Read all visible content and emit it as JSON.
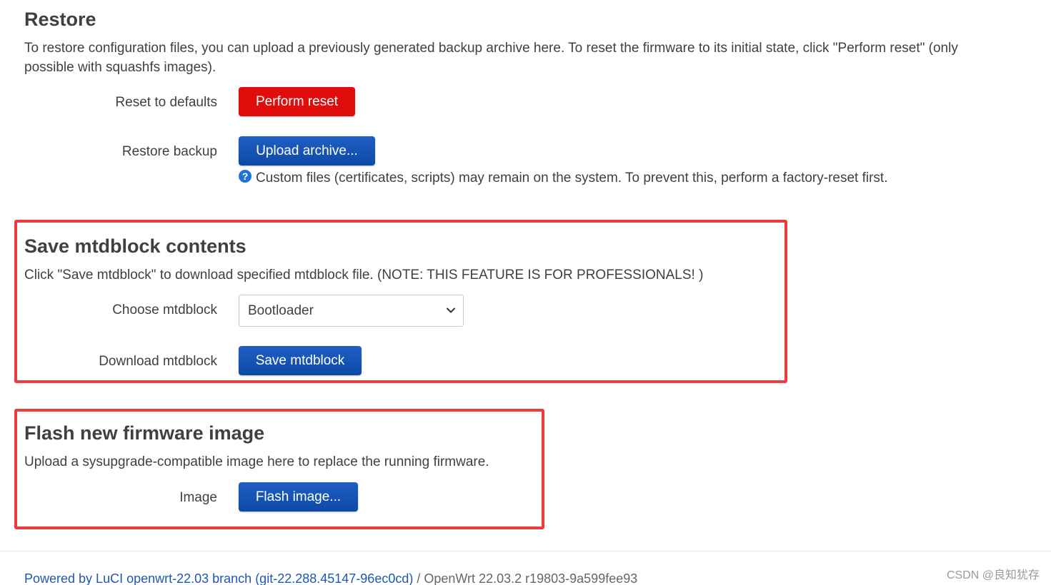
{
  "restore": {
    "title": "Restore",
    "description": "To restore configuration files, you can upload a previously generated backup archive here. To reset the firmware to its initial state, click \"Perform reset\" (only possible with squashfs images).",
    "reset_label": "Reset to defaults",
    "reset_button": "Perform reset",
    "backup_label": "Restore backup",
    "upload_button": "Upload archive...",
    "hint_icon": "?",
    "hint": "Custom files (certificates, scripts) may remain on the system. To prevent this, perform a factory-reset first."
  },
  "mtdblock": {
    "title": "Save mtdblock contents",
    "description": "Click \"Save mtdblock\" to download specified mtdblock file. (NOTE: THIS FEATURE IS FOR PROFESSIONALS! )",
    "choose_label": "Choose mtdblock",
    "selected": "Bootloader",
    "download_label": "Download mtdblock",
    "save_button": "Save mtdblock"
  },
  "flash": {
    "title": "Flash new firmware image",
    "description": "Upload a sysupgrade-compatible image here to replace the running firmware.",
    "image_label": "Image",
    "flash_button": "Flash image..."
  },
  "footer": {
    "link": "Powered by LuCI openwrt-22.03 branch (git-22.288.45147-96ec0cd)",
    "separator": " / ",
    "version": "OpenWrt 22.03.2 r19803-9a599fee93"
  },
  "watermark": "CSDN @良知犹存",
  "colors": {
    "primary_button": "#0d4aa6",
    "danger_button": "#e00d0d",
    "highlight_border": "#ee3b3b",
    "link": "#1b59b3"
  }
}
